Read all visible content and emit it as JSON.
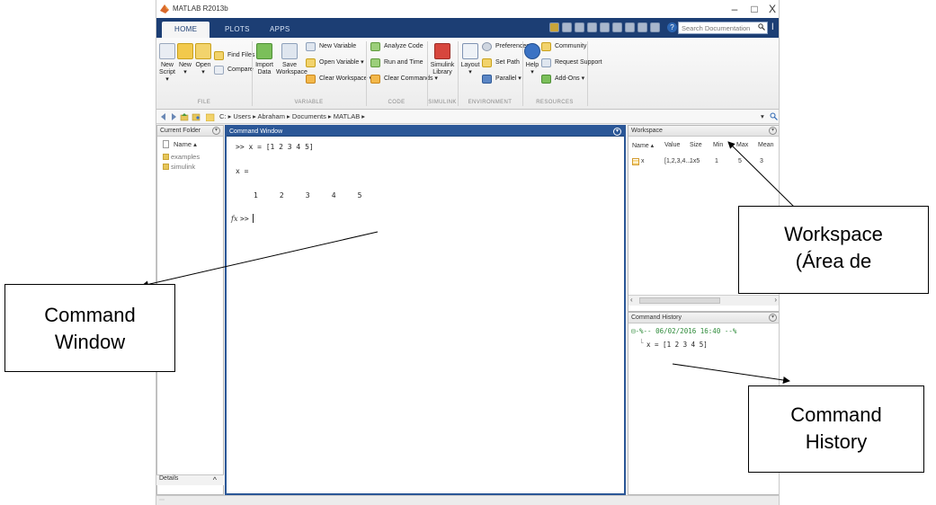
{
  "window": {
    "title": "MATLAB R2013b",
    "controls": {
      "minimize": "–",
      "restore": "□",
      "close": "X"
    }
  },
  "toolstrip": {
    "tabs": [
      "HOME",
      "PLOTS",
      "APPS"
    ],
    "search_placeholder": "Search Documentation"
  },
  "ribbon": {
    "file": {
      "new_script": [
        "New",
        "Script",
        "▾"
      ],
      "new": [
        "New",
        "▾"
      ],
      "open": [
        "Open",
        "▾"
      ],
      "find_files": "Find Files",
      "compare": "Compare",
      "group_label": "FILE"
    },
    "variable": {
      "import_data": [
        "Import",
        "Data"
      ],
      "save_workspace": [
        "Save",
        "Workspace"
      ],
      "new_variable": "New Variable",
      "open_variable": "Open Variable ▾",
      "clear_workspace": "Clear Workspace ▾",
      "group_label": "VARIABLE"
    },
    "code": {
      "analyze_code": "Analyze Code",
      "run_and_time": "Run and Time",
      "clear_commands": "Clear Commands ▾",
      "group_label": "CODE"
    },
    "simulink": {
      "library": [
        "Simulink",
        "Library"
      ],
      "group_label": "SIMULINK"
    },
    "environment": {
      "layout": [
        "Layout",
        "▾"
      ],
      "preferences": "Preferences",
      "set_path": "Set Path",
      "parallel": "Parallel ▾",
      "group_label": "ENVIRONMENT"
    },
    "resources": {
      "help": [
        "Help",
        "▾"
      ],
      "community": "Community",
      "request_support": "Request Support",
      "add_ons": "Add-Ons ▾",
      "group_label": "RESOURCES"
    }
  },
  "address": {
    "path": "C: ▸ Users ▸ Abraham ▸ Documents ▸ MATLAB ▸"
  },
  "current_folder": {
    "title": "Current Folder",
    "column": "Name ▴",
    "items": [
      "examples",
      "simulink"
    ],
    "details": "Details"
  },
  "command_window": {
    "title": "Command Window",
    "lines": [
      ">> x = [1 2 3 4 5]",
      "x =",
      "1     2     3     4     5"
    ],
    "fx": "fx",
    "prompt": ">>"
  },
  "workspace": {
    "title": "Workspace",
    "columns": [
      "Name ▴",
      "Value",
      "Size",
      "Min",
      "Max",
      "Mean"
    ],
    "rows": [
      {
        "name": "x",
        "value": "[1,2,3,4...",
        "size": "1x5",
        "min": "1",
        "max": "5",
        "mean": "3"
      }
    ]
  },
  "command_history": {
    "title": "Command History",
    "session": "⊟-%-- 06/02/2016 16:40 --%",
    "entries": [
      "x = [1 2 3 4 5]"
    ]
  },
  "annotations": {
    "command_window": [
      "Command",
      "Window"
    ],
    "workspace": [
      "Workspace",
      "(Área de"
    ],
    "command_history": [
      "Command",
      "History"
    ]
  },
  "colors": {
    "toolstrip_blue": "#1c3e74",
    "panel_active_blue": "#2b5797",
    "history_green": "#2e8b3a"
  }
}
